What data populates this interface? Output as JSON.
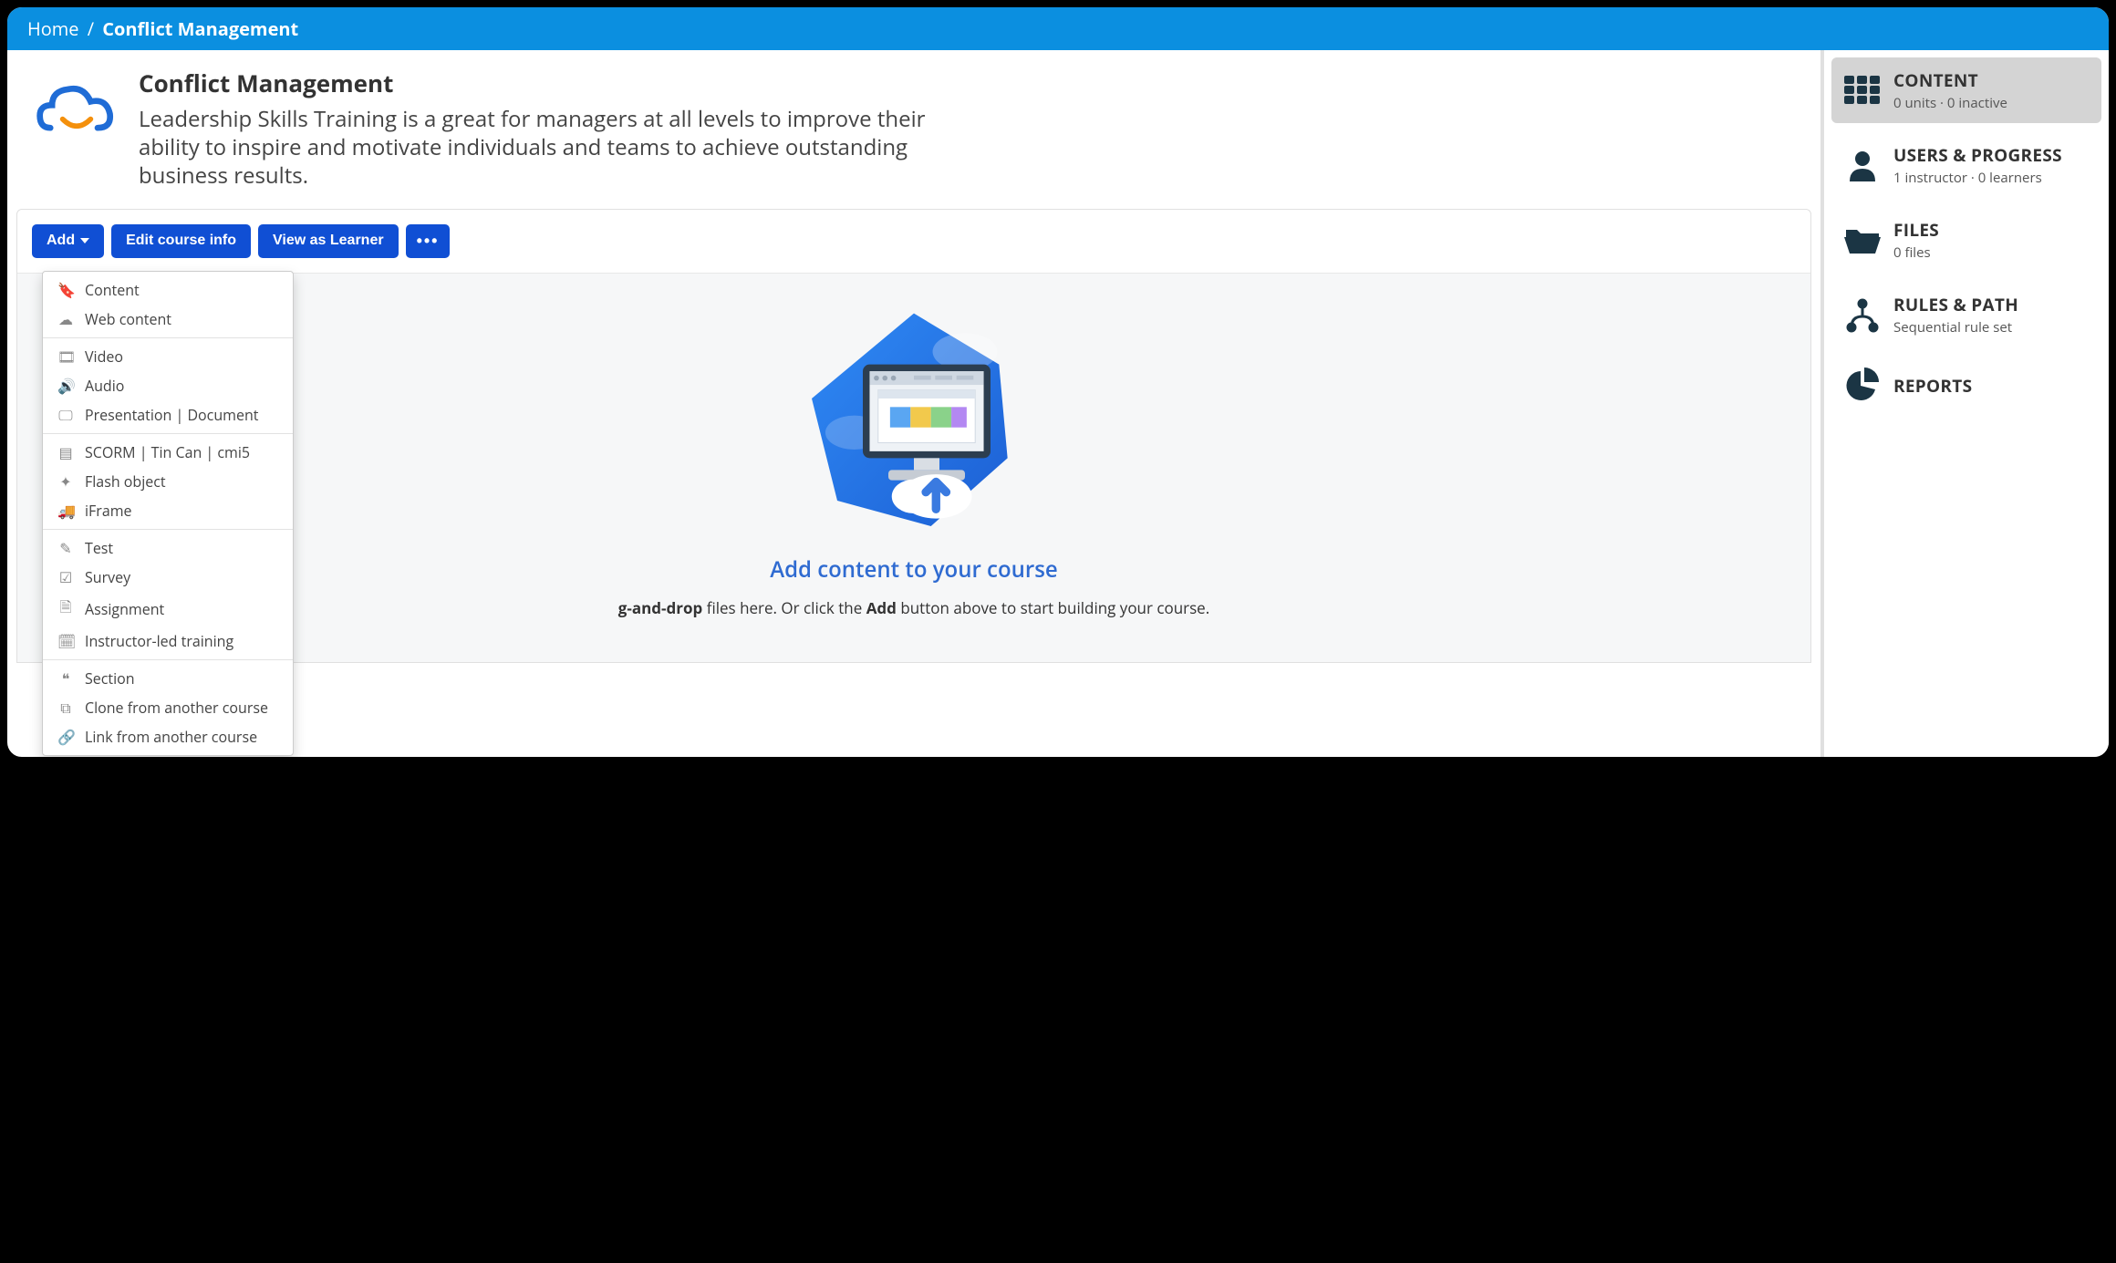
{
  "breadcrumb": {
    "home": "Home",
    "sep": "/",
    "title": "Conflict Management"
  },
  "course": {
    "title": "Conflict Management",
    "description": "Leadership Skills Training is a great for managers at all levels to improve their ability to inspire and motivate individuals and teams to achieve outstanding business results."
  },
  "toolbar": {
    "add": "Add",
    "edit": "Edit course info",
    "view": "View as Learner",
    "more": "•••"
  },
  "addMenu": {
    "g1": {
      "content": "Content",
      "web": "Web content"
    },
    "g2": {
      "video": "Video",
      "audio": "Audio",
      "pres": "Presentation | Document"
    },
    "g3": {
      "scorm": "SCORM | Tin Can | cmi5",
      "flash": "Flash object",
      "iframe": "iFrame"
    },
    "g4": {
      "test": "Test",
      "survey": "Survey",
      "assign": "Assignment",
      "ilt": "Instructor-led training"
    },
    "g5": {
      "section": "Section",
      "clone": "Clone from another course",
      "link": "Link from another course"
    }
  },
  "empty": {
    "title": "Add content to your course",
    "pre": "g-and-drop",
    "mid": " files here. Or click the ",
    "bold": "Add",
    "post": " button above to start building your course."
  },
  "sidebar": {
    "content": {
      "label": "CONTENT",
      "sub": "0 units · 0 inactive"
    },
    "users": {
      "label": "USERS & PROGRESS",
      "sub": "1 instructor · 0 learners"
    },
    "files": {
      "label": "FILES",
      "sub": "0 files"
    },
    "rules": {
      "label": "RULES & PATH",
      "sub": "Sequential rule set"
    },
    "reports": {
      "label": "REPORTS"
    }
  }
}
